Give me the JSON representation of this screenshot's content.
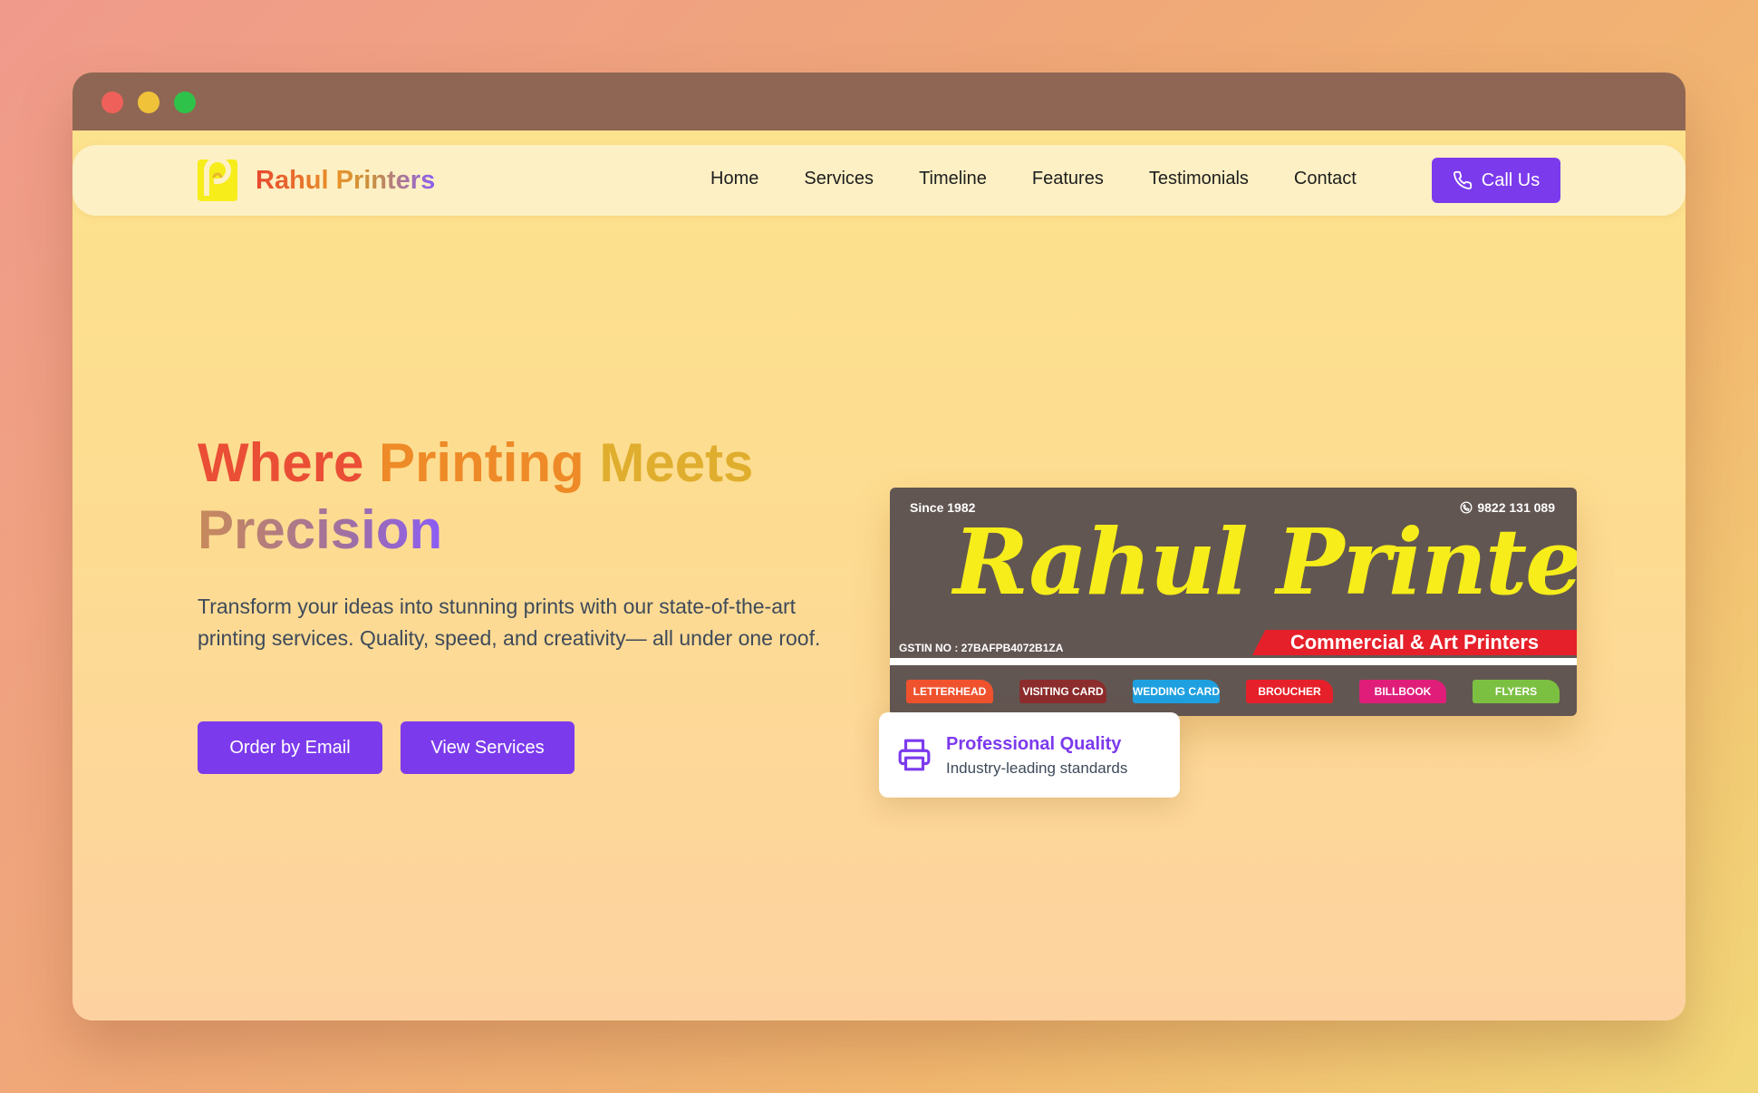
{
  "window": {
    "dots": [
      "close",
      "minimize",
      "maximize"
    ]
  },
  "nav": {
    "brand_name": "Rahul Printers",
    "links": [
      "Home",
      "Services",
      "Timeline",
      "Features",
      "Testimonials",
      "Contact"
    ],
    "call_label": "Call Us"
  },
  "hero": {
    "title_words": [
      "Where",
      "Printing",
      "Meets",
      "Precision"
    ],
    "subtitle": "Transform your ideas into stunning prints with our state-of-the-art printing services. Quality, speed, and creativity— all under one roof.",
    "order_button": "Order by Email",
    "services_button": "View Services"
  },
  "banner": {
    "since": "Since 1982",
    "phone": "9822 131 089",
    "name": "Rahul Printers",
    "gstin": "GSTIN NO : 27BAFPB4072B1ZA",
    "tagline": "Commercial & Art Printers",
    "tags": [
      {
        "label": "LETTERHEAD",
        "color": "#f0522e"
      },
      {
        "label": "VISITING CARD",
        "color": "#8c2c2c"
      },
      {
        "label": "WEDDING CARD",
        "color": "#1ea0e0"
      },
      {
        "label": "BROUCHER",
        "color": "#e6202a"
      },
      {
        "label": "BILLBOOK",
        "color": "#e01e7a"
      },
      {
        "label": "FLYERS",
        "color": "#7cc042"
      }
    ]
  },
  "quality_card": {
    "title": "Professional Quality",
    "subtitle": "Industry-leading standards"
  },
  "colors": {
    "accent": "#7c3aed",
    "nav_bg": "#fdf0c4"
  }
}
